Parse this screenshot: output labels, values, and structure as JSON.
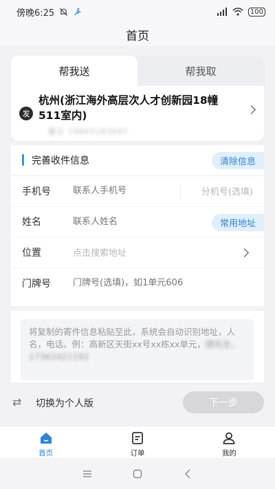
{
  "status_bar": {
    "time": "傍晚6:25",
    "battery": "100"
  },
  "nav": {
    "title": "首页"
  },
  "tabs": {
    "send": "帮我送",
    "pickup": "帮我取"
  },
  "sender": {
    "badge": "发",
    "address": "杭州(浙江海外高层次人才创新园18幢511室内)",
    "contact": "董沙 19867183697"
  },
  "form": {
    "section_title": "完善收件信息",
    "clear_label": "清除信息",
    "phone": {
      "label": "手机号",
      "placeholder": "联系人手机号",
      "ext_placeholder": "分机号(选填)"
    },
    "name": {
      "label": "姓名",
      "placeholder": "联系人姓名",
      "address_book": "常用地址"
    },
    "location": {
      "label": "位置",
      "placeholder": "点击搜索地址"
    },
    "door": {
      "label": "门牌号",
      "placeholder": "门牌号(选填)，如1单元606"
    }
  },
  "paste": {
    "hint": "将复制的寄件信息粘贴至此，系统会自动识别地址，人名，电话。例：高新区天街xx号xx栋xx单元，",
    "hint_blurred": "顺先生，17362421192"
  },
  "bottom": {
    "switch_label": "切换为个人版",
    "next_label": "下一步"
  },
  "tabbar": {
    "home": "首页",
    "orders": "订单",
    "mine": "我的"
  },
  "colors": {
    "accent": "#2f84d8",
    "pill_bg": "#e1effb"
  }
}
